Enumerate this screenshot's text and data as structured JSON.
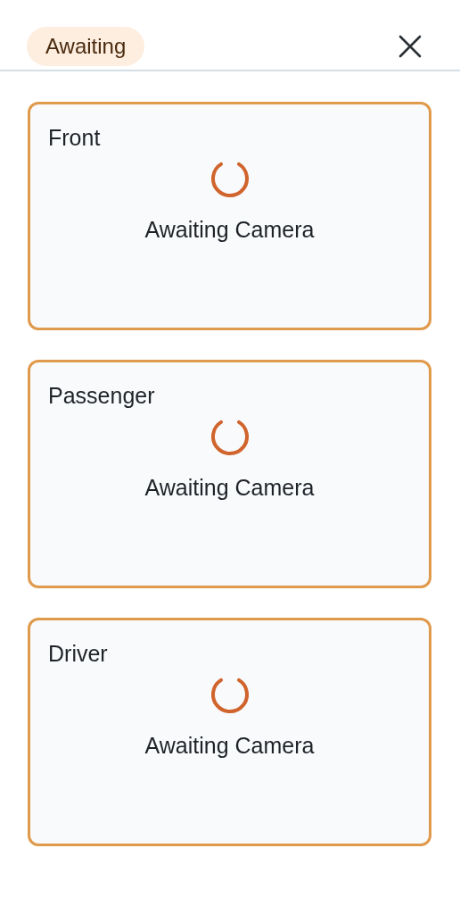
{
  "header": {
    "status_badge": "Awaiting"
  },
  "cameras": [
    {
      "title": "Front",
      "status": "Awaiting Camera",
      "loading": true
    },
    {
      "title": "Passenger",
      "status": "Awaiting Camera",
      "loading": true
    },
    {
      "title": "Driver",
      "status": "Awaiting Camera",
      "loading": true
    }
  ]
}
